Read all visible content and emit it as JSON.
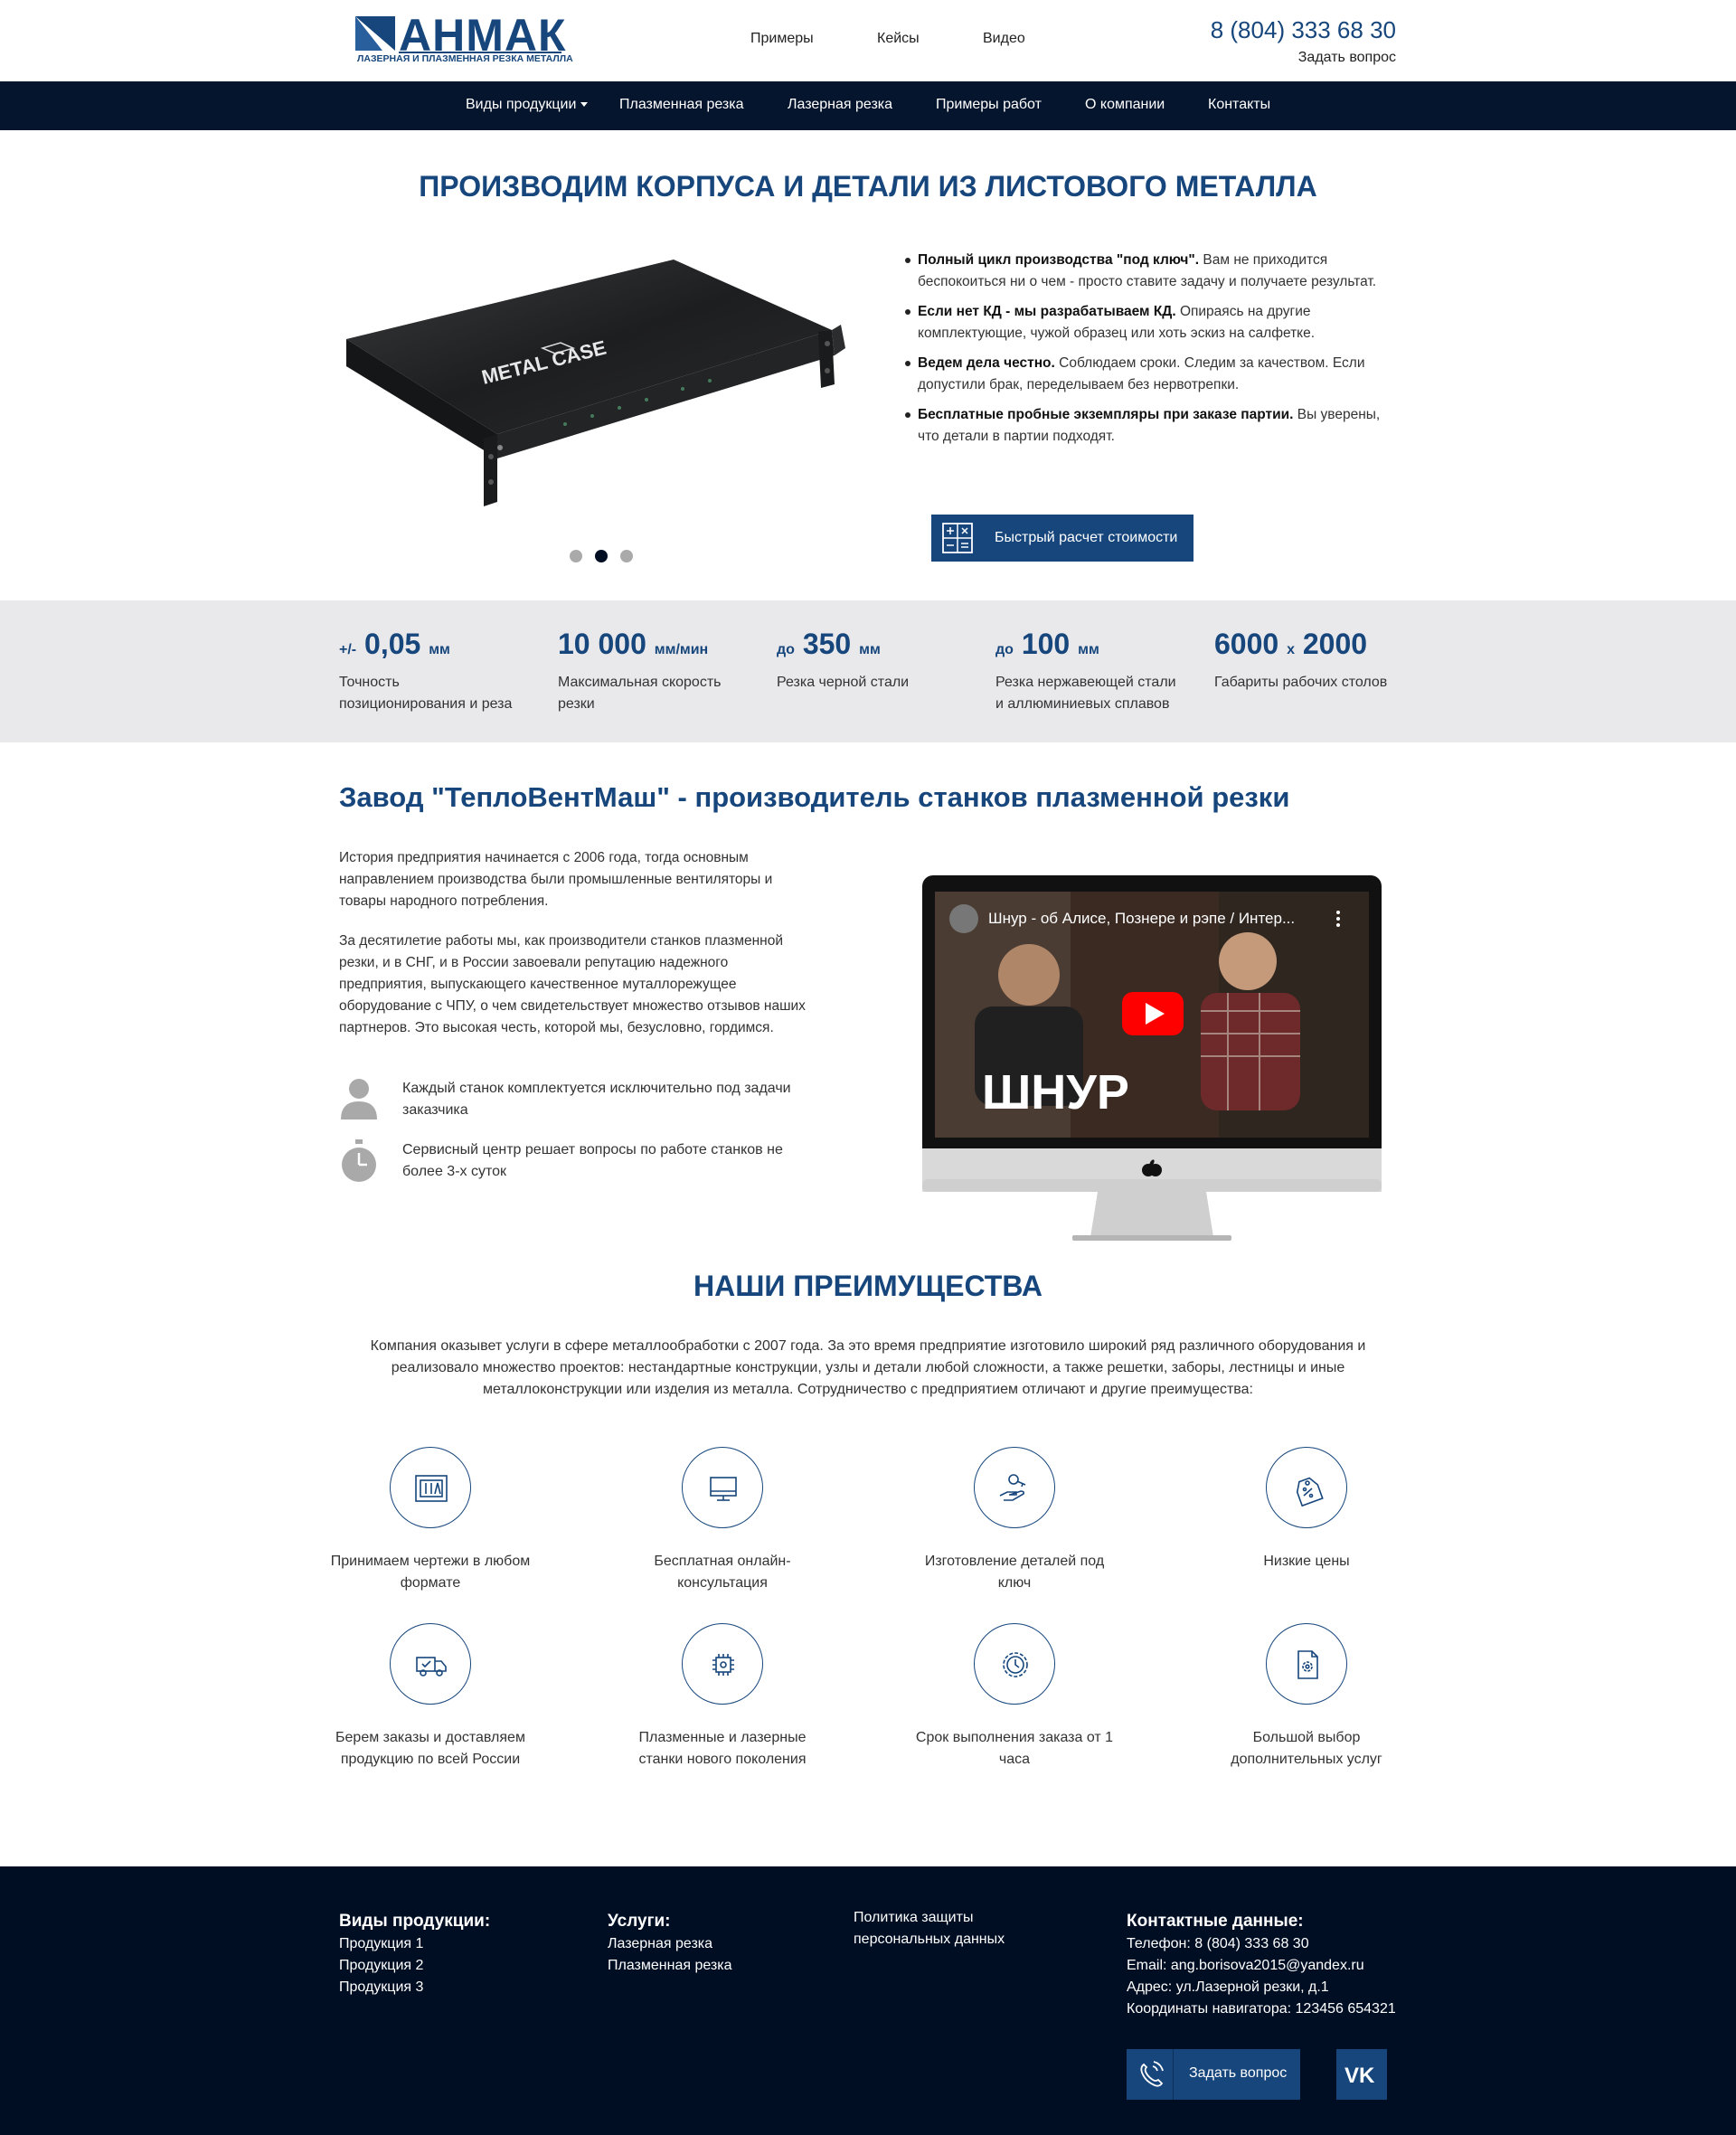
{
  "header": {
    "logo_text": "АНМАК",
    "logo_subtitle": "ЛАЗЕРНАЯ И ПЛАЗМЕННАЯ РЕЗКА МЕТАЛЛА",
    "top_links": [
      "Примеры",
      "Кейсы",
      "Видео"
    ],
    "phone": "8 (804) 333 68 30",
    "ask_link": "Задать вопрос"
  },
  "nav": {
    "items": [
      "Виды продукции",
      "Плазменная резка",
      "Лазерная резка",
      "Примеры работ",
      "О компании",
      "Контакты"
    ]
  },
  "hero": {
    "title": "ПРОИЗВОДИМ КОРПУСА И ДЕТАЛИ ИЗ ЛИСТОВОГО МЕТАЛЛА",
    "image_label": "METAL CASE",
    "slides_total": 3,
    "slide_active": 2,
    "bullets": [
      {
        "bold": "Полный цикл производства \"под ключ\".",
        "text": " Вам не приходится беспокоиться ни о чем - просто ставите задачу и получаете результат."
      },
      {
        "bold": "Если нет КД - мы разрабатываем КД.",
        "text": " Опираясь на другие комплектующие, чужой образец или хоть эскиз на салфетке."
      },
      {
        "bold": "Ведем дела честно.",
        "text": " Соблюдаем сроки. Следим за качеством. Если допустили брак, переделываем без нервотрепки."
      },
      {
        "bold": "Бесплатные пробные экземпляры при заказе партии.",
        "text": " Вы уверены, что детали в партии подходят."
      }
    ],
    "calc_button": "Быстрый расчет стоимости"
  },
  "stats": [
    {
      "prefix": "+/-",
      "value": "0,05",
      "unit": "мм",
      "desc": "Точность позиционирования и реза"
    },
    {
      "prefix": "",
      "value": "10 000",
      "unit": "мм/мин",
      "desc": "Максимальная скорость резки"
    },
    {
      "prefix": "до",
      "value": "350",
      "unit": "мм",
      "desc": "Резка черной стали"
    },
    {
      "prefix": "до",
      "value": "100",
      "unit": "мм",
      "desc": "Резка нержавеющей стали и аллюминиевых сплавов"
    },
    {
      "prefix": "",
      "value": "6000",
      "unit": "x",
      "value2": "2000",
      "desc": "Габариты рабочих столов"
    }
  ],
  "about": {
    "title": "Завод \"ТеплоВентМаш\" - производитель станков плазменной резки",
    "paragraphs": [
      "История предприятия начинается с 2006 года, тогда основным направлением производства были промышленные вентиляторы и товары народного потребления.",
      "За десятилетие работы мы, как производители станков плазменной резки, и в СНГ, и в России завоевали репутацию надежного предприятия, выпускающего качественное муталлорежущее оборудование с ЧПУ, о чем свидетельствует множество отзывов наших партнеров. Это высокая честь, которой мы, безусловно, гордимся."
    ],
    "features": [
      "Каждый станок комплектуется исключительно под задачи заказчика",
      "Сервисный центр решает вопросы по работе станков не более 3-х суток"
    ],
    "video_title": "Шнур - об Алисе, Познере и рэпе / Интер...",
    "video_overlay": "ШНУР"
  },
  "advantages": {
    "title": "НАШИ ПРЕИМУЩЕСТВА",
    "intro": "Компания оказывет услуги в сфере металлообработки с 2007 года. За это время предприятие изготовило широкий ряд различного оборудования и реализовало множество проектов: нестандартные конструкции, узлы и детали любой сложности, а также решетки, заборы, лестницы и иные металлоконструкции или изделия из металла. Сотрудничество с предприятием отличают и другие преимущества:",
    "items": [
      {
        "icon": "blueprint-icon",
        "label": "Принимаем чертежи в любом формате"
      },
      {
        "icon": "monitor-icon",
        "label": "Бесплатная онлайн-консультация"
      },
      {
        "icon": "hand-key-icon",
        "label": "Изготовление деталей под ключ"
      },
      {
        "icon": "price-tag-icon",
        "label": "Низкие цены"
      },
      {
        "icon": "delivery-truck-icon",
        "label": "Берем заказы и доставляем продукцию по всей России"
      },
      {
        "icon": "chip-icon",
        "label": "Плазменные и лазерные станки нового поколения"
      },
      {
        "icon": "clock-gear-icon",
        "label": "Срок выполнения заказа от 1 часа"
      },
      {
        "icon": "document-gear-icon",
        "label": "Большой выбор дополнительных услуг"
      }
    ]
  },
  "footer": {
    "products_title": "Виды продукции:",
    "products": [
      "Продукция 1",
      "Продукция 2",
      "Продукция 3"
    ],
    "services_title": "Услуги:",
    "services": [
      "Лазерная резка",
      "Плазменная резка"
    ],
    "policy": [
      "Политика защиты",
      "персональных данных"
    ],
    "contacts_title": "Контактные данные:",
    "contacts": [
      "Телефон: 8 (804) 333 68 30",
      "Email: ang.borisova2015@yandex.ru",
      "Адрес: ул.Лазерной резки, д.1",
      "Координаты навигатора: 123456 654321"
    ],
    "ask_button": "Задать вопрос",
    "vk_label": "VK"
  },
  "colors": {
    "brand": "#16467c",
    "nav_bg": "#06152e",
    "footer_bg": "#000e24",
    "stats_bg": "#e9e9eb"
  }
}
